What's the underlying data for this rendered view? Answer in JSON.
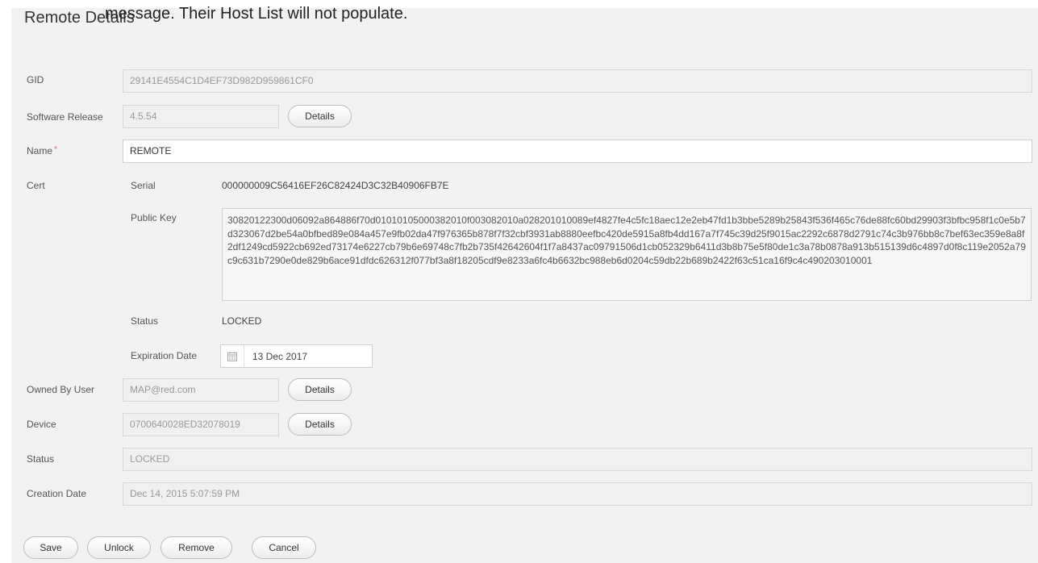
{
  "overlay": "message. Their Host List will not populate.",
  "panel_title": "Remote Details",
  "fields": {
    "gid": {
      "label": "GID",
      "value": "29141E4554C1D4EF73D982D959861CF0"
    },
    "software_release": {
      "label": "Software Release",
      "value": "4.5.54",
      "button": "Details"
    },
    "name": {
      "label": "Name",
      "required": "*",
      "value": "REMOTE"
    },
    "cert": {
      "label": "Cert",
      "serial_label": "Serial",
      "serial_value": "000000009C56416EF26C82424D3C32B40906FB7E",
      "public_key_label": "Public Key",
      "public_key_value": "30820122300d06092a864886f70d01010105000382010f003082010a028201010089ef4827fe4c5fc18aec12e2eb47fd1b3bbe5289b25843f536f465c76de88fc60bd29903f3bfbc958f1c0e5b7d323067d2be54a0bfbed89e084a457e9fb02da47f976365b878f7f32cbf3931ab8880eefbc420de5915a8fb4dd167a7f745c39d25f9015ac2292c6878d2791c74c3b976bb8c7bef63ec359e8a8f2df1249cd5922cb692ed73174e6227cb79b6e69748c7fb2b735f42642604f1f7a8437ac09791506d1cb052329b6411d3b8b75e5f80de1c3a78b0878a913b515139d6c4897d0f8c119e2052a79c9c631b7290e0de829b6ace91dfdc626312f077bf3a8f18205cdf9e8233a6fc4b6632bc988eb6d0204c59db22b689b2422f63c51ca16f9c4c490203010001",
      "status_label": "Status",
      "status_value": "LOCKED",
      "expiration_label": "Expiration Date",
      "expiration_value": "13 Dec 2017"
    },
    "owned_by_user": {
      "label": "Owned By User",
      "value": "MAP@red.com",
      "button": "Details"
    },
    "device": {
      "label": "Device",
      "value": "0700640028ED32078019",
      "button": "Details"
    },
    "status": {
      "label": "Status",
      "value": "LOCKED"
    },
    "creation_date": {
      "label": "Creation Date",
      "value": "Dec 14, 2015 5:07:59 PM"
    }
  },
  "actions": {
    "save": "Save",
    "unlock": "Unlock",
    "remove": "Remove",
    "cancel": "Cancel"
  }
}
